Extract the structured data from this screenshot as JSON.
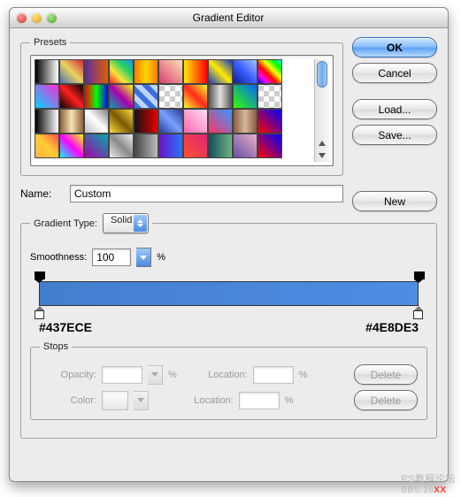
{
  "window": {
    "title": "Gradient Editor"
  },
  "buttons": {
    "ok": "OK",
    "cancel": "Cancel",
    "load": "Load...",
    "save": "Save...",
    "new": "New",
    "delete": "Delete"
  },
  "presets": {
    "legend": "Presets",
    "swatches": [
      "linear-gradient(90deg,#000,#fff)",
      "linear-gradient(45deg,#4b6cb7,#e9d362,#d7263d)",
      "linear-gradient(90deg,#5a2ca0,#e35d05)",
      "linear-gradient(45deg,#ff1e1e,#ffe13d,#23d160,#1e90ff)",
      "linear-gradient(90deg,#ff7a00,#ffd400,#ff7a00)",
      "linear-gradient(45deg,#d73c72,#ffe3b3)",
      "linear-gradient(90deg,#ffe900,#ff0000)",
      "linear-gradient(45deg,#1436d8,#ffeb00,#1436d8)",
      "linear-gradient(45deg,#101f8f,#3b60ff,#a7c2ff)",
      "linear-gradient(45deg,#00f,#f0f,#f00,#ff0,#0f0,#0ff)",
      "linear-gradient(45deg,#00d4ff,#ff2ad8)",
      "linear-gradient(45deg,#000,#ff2020,#000)",
      "linear-gradient(90deg,#ff0000,#00ff00,#0000ff)",
      "linear-gradient(45deg,#0aa,#a0a,#ff0)",
      "repeating-linear-gradient(45deg,#3a6fe0 0 6px,#bcd3ff 6px 12px)",
      "repeating-conic-gradient(#ccc 0 25%,#fff 0 50%) 0/12px 12px",
      "linear-gradient(45deg,#f8ff2b,#ff281b,#f8ff2b)",
      "linear-gradient(90deg,#555,#e0e0e0,#555)",
      "linear-gradient(45deg,#3f0,#06f)",
      "repeating-conic-gradient(#ccc 0 25%,#fff 0 50%) 0/12px 12px",
      "linear-gradient(90deg,#000,#fff)",
      "linear-gradient(90deg,#8c6239,#f7e3b5,#8c6239)",
      "linear-gradient(45deg,#c0c0c0,#fff,#808080)",
      "linear-gradient(45deg,#ffda44,#7a5a00,#ffda44)",
      "linear-gradient(90deg,#111,#e60000)",
      "linear-gradient(45deg,#253c99,#7aa0ff,#253c99)",
      "linear-gradient(45deg,#ff66b3,#ffe0f0)",
      "linear-gradient(45deg,#f36,#39f)",
      "linear-gradient(90deg,#8a5a44,#d7b899,#8a5a44)",
      "linear-gradient(45deg,#ff0000,#0000ff)",
      "linear-gradient(45deg,#ffb347,#ffcc33,#ff4e50)",
      "linear-gradient(45deg,#0ff,#f0f,#ff0)",
      "linear-gradient(45deg,#a0a,#0aa)",
      "linear-gradient(45deg,#eee,#888,#eee)",
      "linear-gradient(90deg,#444,#bbb)",
      "linear-gradient(90deg,#6a11cb,#2575fc)",
      "linear-gradient(45deg,#ff512f,#dd2476)",
      "linear-gradient(90deg,#134e5e,#71b280)",
      "linear-gradient(45deg,#654ea3,#eaafc8)",
      "linear-gradient(45deg,#f00,#00f)"
    ]
  },
  "name": {
    "label": "Name:",
    "value": "Custom"
  },
  "gradient_type": {
    "legend": "Gradient Type:",
    "value": "Solid"
  },
  "smoothness": {
    "label": "Smoothness:",
    "value": "100",
    "unit": "%"
  },
  "gradient": {
    "left_hex": "#437ECE",
    "right_hex": "#4E8DE3"
  },
  "stops": {
    "legend": "Stops",
    "opacity_label": "Opacity:",
    "color_label": "Color:",
    "location_label": "Location:",
    "opacity_value": "",
    "opacity_location": "",
    "color_location": "",
    "pct": "%"
  },
  "watermark": {
    "line1": "PS教程论坛",
    "line2_pre": "BBS.16",
    "line2_xx": "XX"
  }
}
